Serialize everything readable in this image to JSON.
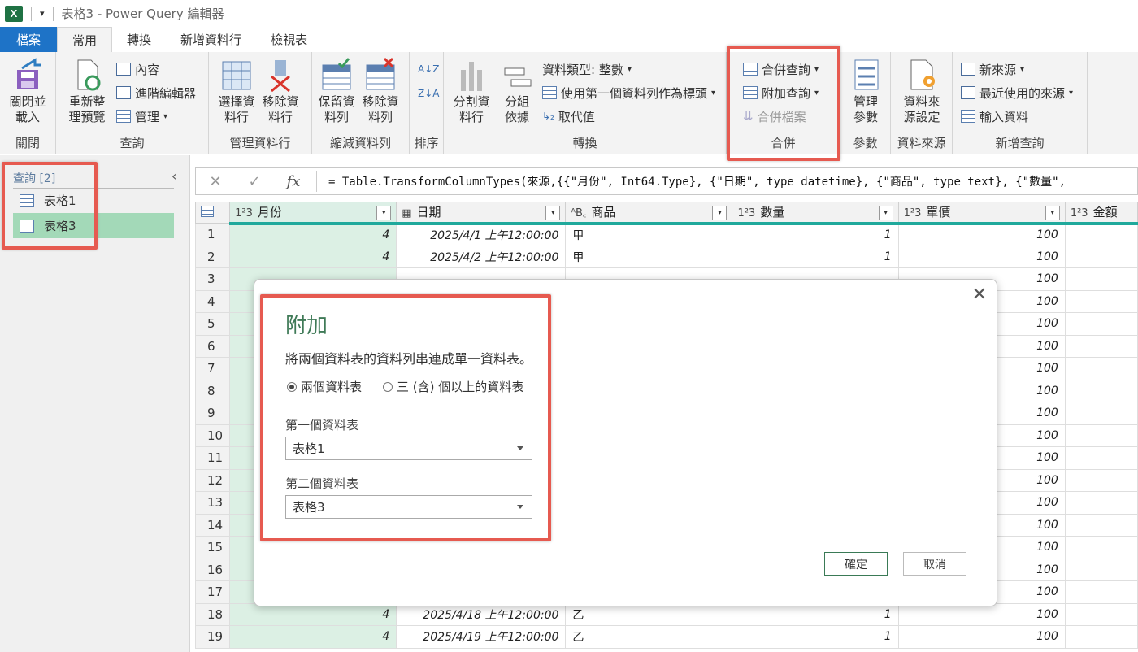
{
  "title_bar": {
    "app_logo": "X",
    "doc_title": "表格3 - Power Query 編輯器"
  },
  "tabs": [
    "檔案",
    "常用",
    "轉換",
    "新增資料行",
    "檢視表"
  ],
  "ribbon": {
    "close": {
      "btn": "關閉並\n載入",
      "label": "關閉"
    },
    "query": {
      "refresh": "重新整\n理預覽",
      "properties": "內容",
      "advanced_editor": "進階編輯器",
      "manage": "管理",
      "label": "查詢"
    },
    "manage_columns": {
      "choose": "選擇資\n料行",
      "remove": "移除資\n料行",
      "label": "管理資料行"
    },
    "reduce_rows": {
      "keep": "保留資\n料列",
      "remove": "移除資\n料列",
      "label": "縮減資料列"
    },
    "sort": {
      "label": "排序"
    },
    "transform": {
      "split": "分割資\n料行",
      "group": "分組\n依據",
      "data_type": "資料類型: 整數",
      "use_first_row": "使用第一個資料列作為標頭",
      "replace": "取代值",
      "label": "轉換"
    },
    "combine": {
      "merge": "合併查詢",
      "append": "附加查詢",
      "combine_files": "合併檔案",
      "label": "合併"
    },
    "params": {
      "btn": "管理\n參數",
      "label": "參數"
    },
    "datasource": {
      "btn": "資料來\n源設定",
      "label": "資料來源"
    },
    "new_query": {
      "new_source": "新來源",
      "recent": "最近使用的來源",
      "enter_data": "輸入資料",
      "label": "新增查詢"
    }
  },
  "queries": {
    "header": "查詢 [2]",
    "items": [
      "表格1",
      "表格3"
    ],
    "selected": "表格3"
  },
  "formula_bar": {
    "fx": "fx",
    "formula": "= Table.TransformColumnTypes(來源,{{\"月份\", Int64.Type}, {\"日期\", type datetime}, {\"商品\", type text}, {\"數量\","
  },
  "grid": {
    "columns": [
      {
        "type": "1²3",
        "name": "月份"
      },
      {
        "type": "▦",
        "name": "日期"
      },
      {
        "type": "ᴬB꜀",
        "name": "商品"
      },
      {
        "type": "1²3",
        "name": "數量"
      },
      {
        "type": "1²3",
        "name": "單價"
      },
      {
        "type": "1²3",
        "name": "金額"
      }
    ],
    "rows": [
      [
        "1",
        "4",
        "2025/4/1 上午12:00:00",
        "甲",
        "1",
        "100"
      ],
      [
        "2",
        "4",
        "2025/4/2 上午12:00:00",
        "甲",
        "1",
        "100"
      ],
      [
        "3",
        "",
        "",
        "",
        "",
        "100"
      ],
      [
        "4",
        "",
        "",
        "",
        "",
        "100"
      ],
      [
        "5",
        "",
        "",
        "",
        "",
        "100"
      ],
      [
        "6",
        "",
        "",
        "",
        "",
        "100"
      ],
      [
        "7",
        "",
        "",
        "",
        "",
        "100"
      ],
      [
        "8",
        "",
        "",
        "",
        "",
        "100"
      ],
      [
        "9",
        "",
        "",
        "",
        "",
        "100"
      ],
      [
        "10",
        "",
        "",
        "",
        "",
        "100"
      ],
      [
        "11",
        "",
        "",
        "",
        "",
        "100"
      ],
      [
        "12",
        "",
        "",
        "",
        "",
        "100"
      ],
      [
        "13",
        "",
        "",
        "",
        "",
        "100"
      ],
      [
        "14",
        "",
        "",
        "",
        "",
        "100"
      ],
      [
        "15",
        "",
        "",
        "",
        "",
        "100"
      ],
      [
        "16",
        "",
        "",
        "",
        "",
        "100"
      ],
      [
        "17",
        "",
        "",
        "",
        "",
        "100"
      ],
      [
        "18",
        "4",
        "2025/4/18 上午12:00:00",
        "乙",
        "1",
        "100"
      ],
      [
        "19",
        "4",
        "2025/4/19 上午12:00:00",
        "乙",
        "1",
        "100"
      ]
    ]
  },
  "dialog": {
    "title": "附加",
    "description": "將兩個資料表的資料列串連成單一資料表。",
    "radio_two": "兩個資料表",
    "radio_three": "三 (含) 個以上的資料表",
    "first_label": "第一個資料表",
    "first_value": "表格1",
    "second_label": "第二個資料表",
    "second_value": "表格3",
    "ok": "確定",
    "cancel": "取消",
    "close": "✕"
  }
}
